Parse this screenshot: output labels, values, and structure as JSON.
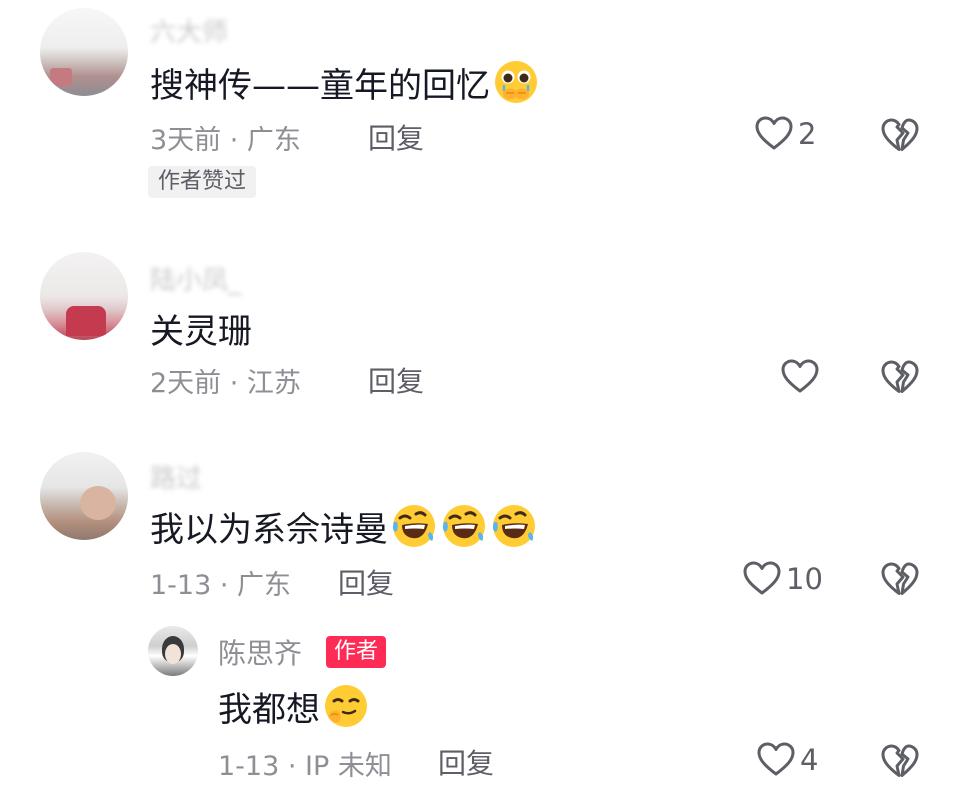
{
  "comments": [
    {
      "username": "六大师",
      "text": "搜神传——童年的回忆",
      "emoji": "pleading-face-emoji",
      "meta": "3天前 · 广东",
      "reply_label": "回复",
      "likes": "2",
      "liked_tag": "作者赞过"
    },
    {
      "username": "陆小凤_",
      "text": "关灵珊",
      "meta": "2天前 · 江苏",
      "reply_label": "回复",
      "likes": ""
    },
    {
      "username": "路过",
      "text": "我以为系佘诗曼",
      "emoji": "rolling-on-floor-laughing-emoji",
      "meta": "1-13 · 广东",
      "reply_label": "回复",
      "likes": "10",
      "replies": [
        {
          "username": "陈思齐",
          "author_tag": "作者",
          "text": "我都想",
          "emoji": "smirking-face-emoji",
          "meta": "1-13 · IP 未知",
          "reply_label": "回复",
          "likes": "4"
        }
      ]
    }
  ],
  "colors": {
    "text": "#161823",
    "meta": "#8e8f95",
    "icon": "#5d5e66",
    "author_tag_bg": "#fe2c55",
    "liked_tag_bg": "#f1f1f2"
  }
}
